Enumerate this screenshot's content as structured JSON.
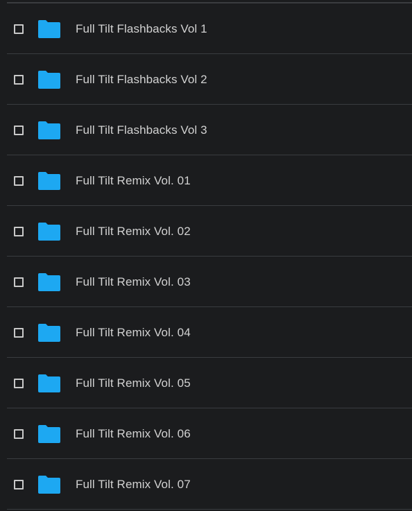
{
  "files": {
    "folder_color": "#1da8f2",
    "items": [
      {
        "name": "Full Tilt Flashbacks Vol 1",
        "icon": "folder-icon",
        "checked": false
      },
      {
        "name": "Full Tilt Flashbacks Vol 2",
        "icon": "folder-icon",
        "checked": false
      },
      {
        "name": "Full Tilt Flashbacks Vol 3",
        "icon": "folder-icon",
        "checked": false
      },
      {
        "name": "Full Tilt Remix Vol. 01",
        "icon": "folder-icon",
        "checked": false
      },
      {
        "name": "Full Tilt Remix Vol. 02",
        "icon": "folder-icon",
        "checked": false
      },
      {
        "name": "Full Tilt Remix Vol. 03",
        "icon": "folder-icon",
        "checked": false
      },
      {
        "name": "Full Tilt Remix Vol. 04",
        "icon": "folder-icon",
        "checked": false
      },
      {
        "name": "Full Tilt Remix Vol. 05",
        "icon": "folder-icon",
        "checked": false
      },
      {
        "name": "Full Tilt Remix Vol. 06",
        "icon": "folder-icon",
        "checked": false
      },
      {
        "name": "Full Tilt Remix Vol. 07",
        "icon": "folder-icon",
        "checked": false
      }
    ]
  }
}
